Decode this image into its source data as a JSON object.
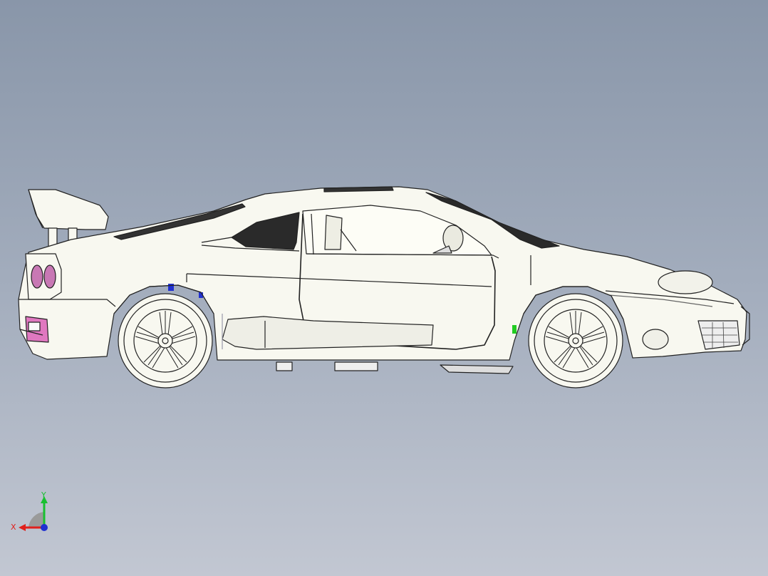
{
  "view": {
    "background_top": "#8996a9",
    "background_bottom": "#c2c7d2",
    "model": "sports-car-side-view"
  },
  "triad": {
    "x_label": "X",
    "y_label": "Y",
    "x_color": "#e0201c",
    "y_color": "#18c030",
    "z_color": "#2030d0"
  }
}
